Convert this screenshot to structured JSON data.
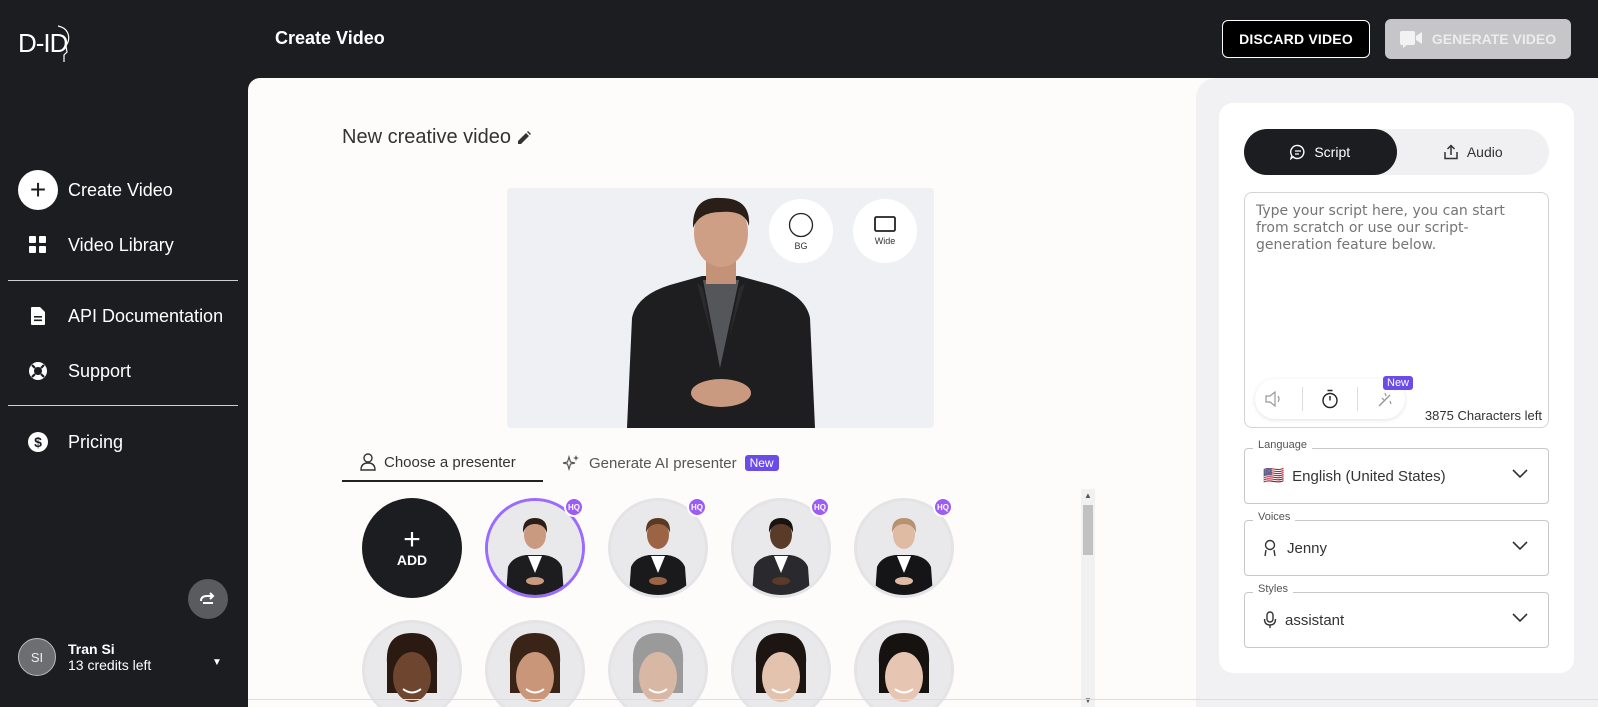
{
  "brand": {
    "logo_text": "D-ID"
  },
  "header": {
    "title": "Create Video",
    "discard_label": "DISCARD VIDEO",
    "generate_label": "GENERATE VIDEO"
  },
  "sidebar": {
    "items": [
      {
        "label": "Create Video",
        "icon": "plus-icon"
      },
      {
        "label": "Video Library",
        "icon": "grid-icon"
      },
      {
        "label": "API Documentation",
        "icon": "document-icon"
      },
      {
        "label": "Support",
        "icon": "lifebuoy-icon"
      },
      {
        "label": "Pricing",
        "icon": "dollar-icon"
      }
    ],
    "user": {
      "initials": "SI",
      "name": "Tran Si",
      "credits": "13 credits left"
    }
  },
  "editor": {
    "video_title": "New creative video",
    "preview_options": [
      {
        "label": "BG",
        "icon": "circle-icon"
      },
      {
        "label": "Wide",
        "icon": "rectangle-icon"
      }
    ],
    "tabs": [
      {
        "label": "Choose a presenter",
        "active": true
      },
      {
        "label": "Generate AI presenter",
        "badge": "New",
        "active": false
      }
    ],
    "add_label": "ADD",
    "hq_badge": "HQ",
    "presenters_row1": [
      {
        "selected": true,
        "hq": true,
        "skin": "#c99a80",
        "hair": "#2a1e18",
        "outfit": "#1d1d1f"
      },
      {
        "selected": false,
        "hq": true,
        "skin": "#9a6445",
        "hair": "#5a3a22",
        "outfit": "#1a1a1c"
      },
      {
        "selected": false,
        "hq": true,
        "skin": "#5a3a28",
        "hair": "#1a1410",
        "outfit": "#2a2a2e"
      },
      {
        "selected": false,
        "hq": true,
        "skin": "#e0bba4",
        "hair": "#b69270",
        "outfit": "#151517"
      }
    ],
    "presenters_row2": [
      {
        "skin": "#6e4630",
        "hair": "#2a1a12"
      },
      {
        "skin": "#c9967a",
        "hair": "#3a2418"
      },
      {
        "skin": "#d9b7a5",
        "hair": "#9a9a9a"
      },
      {
        "skin": "#e4c3ae",
        "hair": "#1c1512"
      },
      {
        "skin": "#e6c6b2",
        "hair": "#161210"
      }
    ]
  },
  "script_panel": {
    "tabs": [
      {
        "label": "Script",
        "icon": "chat-icon",
        "active": true
      },
      {
        "label": "Audio",
        "icon": "upload-icon",
        "active": false
      }
    ],
    "placeholder": "Type your script here, you can start from scratch or use our script-generation feature below.",
    "tools_badge": "New",
    "chars_left": "3875 Characters left",
    "language": {
      "label": "Language",
      "flag": "🇺🇸",
      "value": "English (United States)"
    },
    "voices": {
      "label": "Voices",
      "value": "Jenny"
    },
    "styles": {
      "label": "Styles",
      "value": "assistant"
    }
  },
  "colors": {
    "accent": "#6b4ce6",
    "selected_ring": "#9b6bff",
    "dark": "#1c1d20"
  }
}
